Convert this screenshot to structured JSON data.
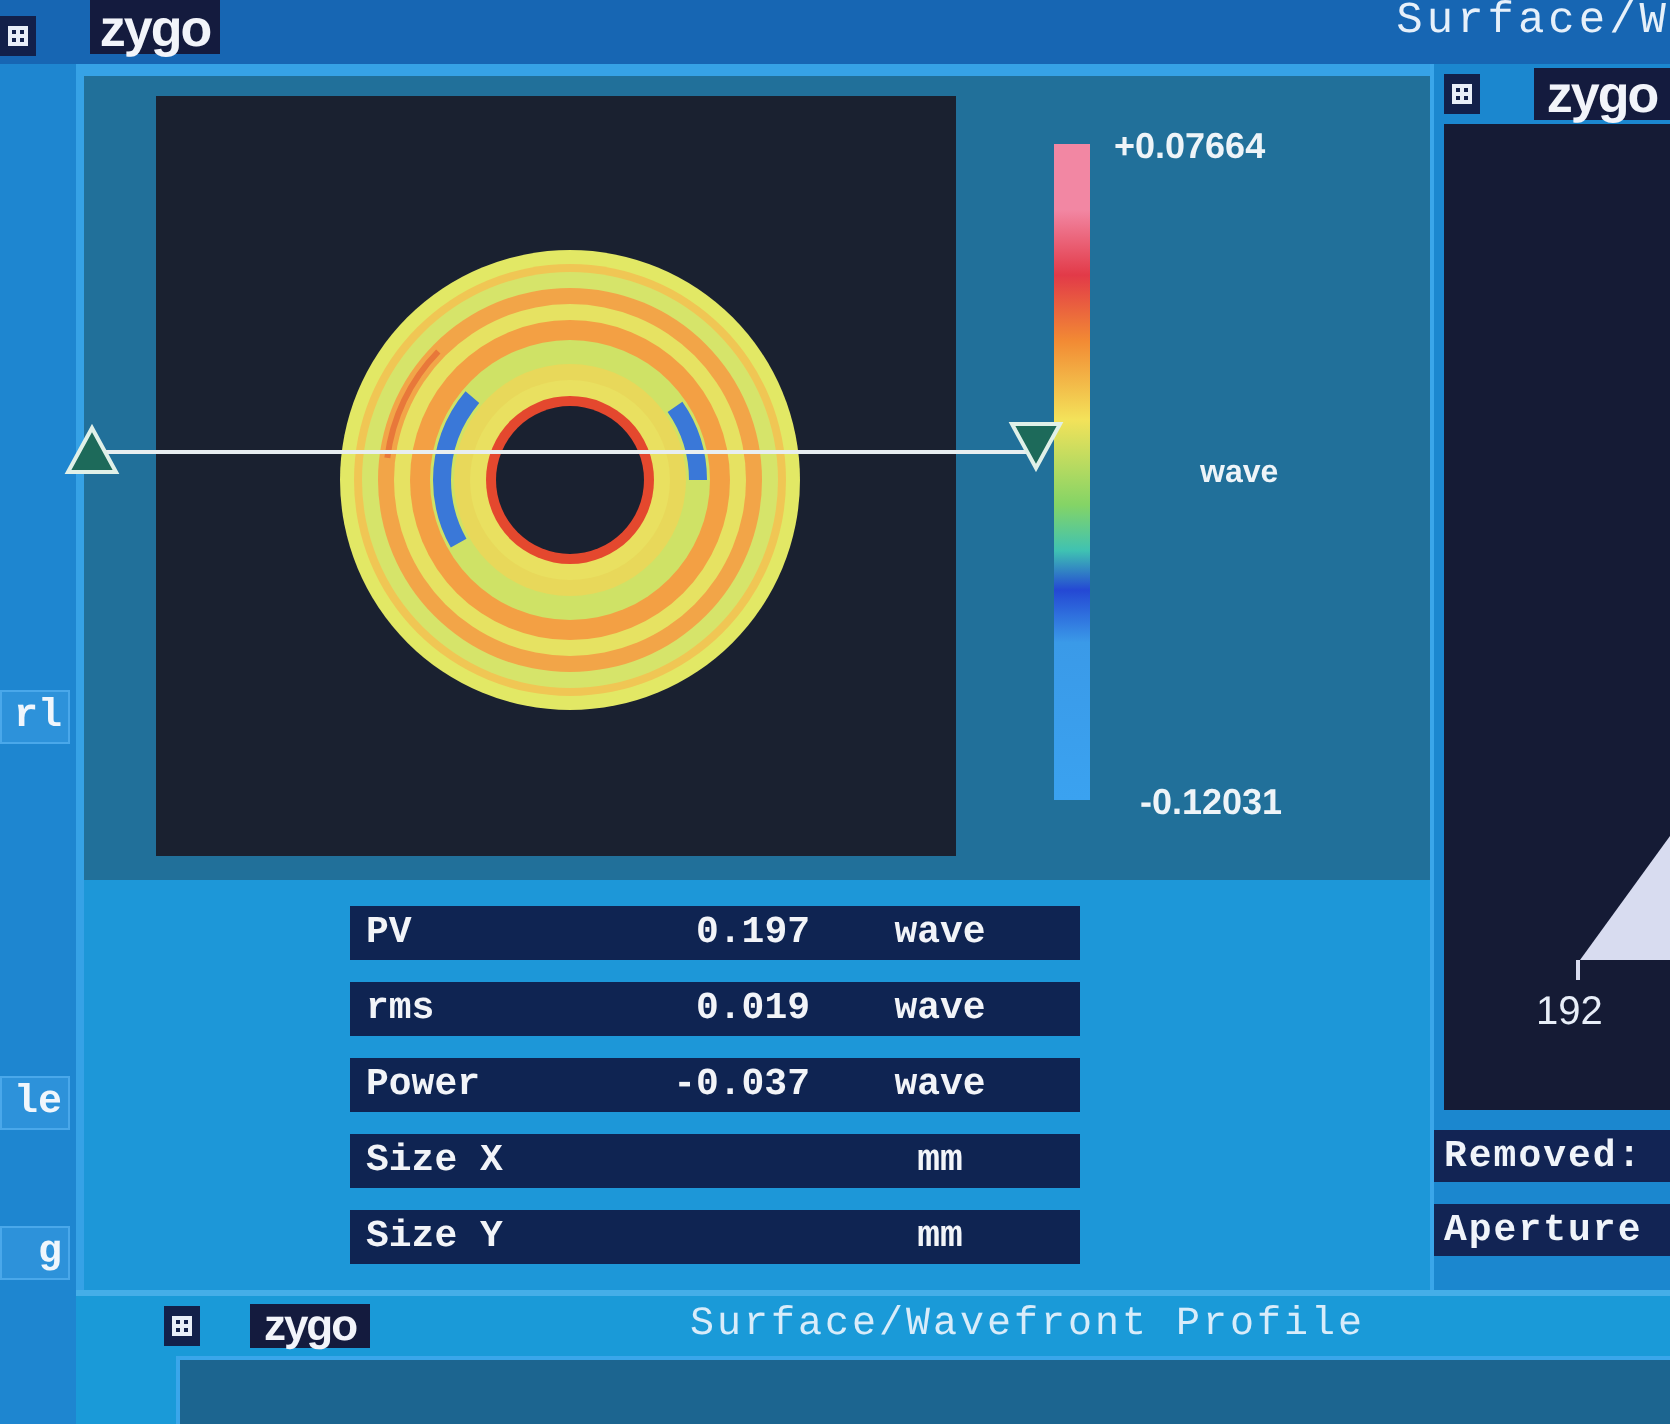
{
  "top_bar": {
    "logo": "zygo",
    "title": "Surface/W"
  },
  "sidebar": {
    "buttons": [
      "rl",
      "le",
      "g"
    ]
  },
  "map_panel": {
    "scale_max": "+0.07664",
    "scale_unit": "wave",
    "scale_min": "-0.12031"
  },
  "results": [
    {
      "label": "PV",
      "value": "0.197",
      "unit": "wave"
    },
    {
      "label": "rms",
      "value": "0.019",
      "unit": "wave"
    },
    {
      "label": "Power",
      "value": "-0.037",
      "unit": "wave"
    },
    {
      "label": "Size X",
      "unit": "mm"
    },
    {
      "label": "Size Y",
      "unit": "mm"
    }
  ],
  "histogram_panel": {
    "logo": "zygo",
    "axis_label": "192",
    "fields": [
      "Removed:",
      "Aperture"
    ]
  },
  "profile_panel": {
    "logo": "zygo",
    "title": "Surface/Wavefront Profile"
  }
}
